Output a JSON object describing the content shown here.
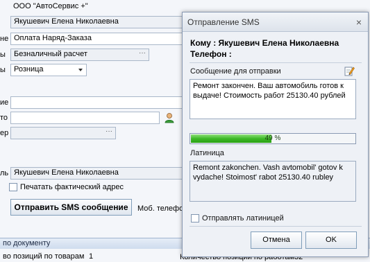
{
  "background_form": {
    "field_org": "ООО \"АвтоСервис +\"",
    "field_person": "Якушевич Елена Николаевна",
    "label_purpose": "не",
    "field_purpose": "Оплата Наряд-Заказа",
    "label_payment": "ы",
    "field_payment": "Безналичный расчет",
    "label_type": "ы",
    "field_type": "Розница",
    "label_blank1": "ие",
    "label_blank2": "то",
    "label_blank3": "ер",
    "ellipsis": "···",
    "label_responsible": "ль",
    "field_responsible": "Якушевич Елена Николаевна",
    "print_address_label": "Печатать фактический адрес",
    "send_sms_button": "Отправить SMS сообщение",
    "mobile_label": "Моб. телефо",
    "bottom_bar": "по документу",
    "count_goods_label": "во позиций по товарам",
    "count_goods_value": "1",
    "count_works_label": "Количество позиций по работам",
    "count_works_value": "32"
  },
  "dialog": {
    "title": "Отправление SMS",
    "close_glyph": "×",
    "to_line": "Кому : Якушевич Елена Николаевна",
    "phone_line": "Телефон :",
    "message_label": "Сообщение для отправки",
    "message_text": "Ремонт закончен. Ваш автомобиль готов к выдаче! Стоимость работ 25130.40 рублей",
    "progress_percent": 49,
    "progress_text": "49 %",
    "latin_label": "Латиница",
    "latin_text": "Remont zakonchen. Vash avtomobil' gotov k vydache! Stoimost' rabot 25130.40 rubley",
    "send_latin_label": "Отправлять латиницей",
    "cancel_button": "Отмена",
    "ok_button": "OK"
  },
  "colors": {
    "accent_border": "#7f9db9",
    "progress_green": "#3db927",
    "bottom_bar_bg": "#cfdcee"
  }
}
